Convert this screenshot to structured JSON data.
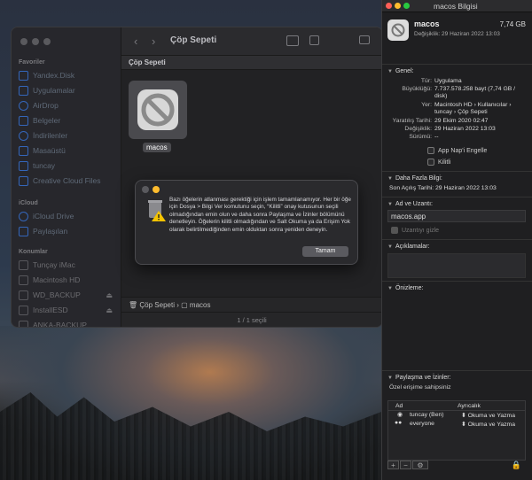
{
  "finder": {
    "title": "Çöp Sepeti",
    "path_header": "Çöp Sepeti",
    "sidebar": {
      "favorites_header": "Favoriler",
      "favorites": [
        "Yandex.Disk",
        "Uygulamalar",
        "AirDrop",
        "Belgeler",
        "İndirilenler",
        "Masaüstü",
        "tuncay",
        "Creative Cloud Files"
      ],
      "icloud_header": "iCloud",
      "icloud": [
        "iCloud Drive",
        "Paylaşılan"
      ],
      "locations_header": "Konumlar",
      "locations": [
        "Tunçay iMac",
        "Macintosh HD",
        "WD_BACKUP",
        "InstallESD",
        "ANKA-BACKUP"
      ]
    },
    "file_label": "macos",
    "pathbar_trash": "Çöp Sepeti",
    "pathbar_sep": "›",
    "pathbar_file": "macos",
    "status": "1 / 1 seçili"
  },
  "alert": {
    "message": "Bazı öğelerin atlanması gerektiği için işlem tamamlanamıyor. Her bir öğe için Dosya > Bilgi Ver komutunu seçin, “Kilitli” onay kutusunun seçili olmadığından emin olun ve daha sonra Paylaşma ve İzinler bölümünü denetleyin. Öğelerin kilitli olmadığından ve Salt Okuma ya da Erişim Yok olarak belirtilmediğinden emin olduktan sonra yeniden deneyin.",
    "ok_label": "Tamam"
  },
  "info": {
    "window_title": "macos Bilgisi",
    "name": "macos",
    "size": "7,74 GB",
    "modified_line": "Değişiklik: 29 Haziran 2022 13:03",
    "general_header": "Genel:",
    "type_k": "Tür:",
    "type_v": "Uygulama",
    "size_k": "Büyüklüğü:",
    "size_v": "7.737.578.258 bayt (7,74 GB / disk)",
    "where_k": "Yer:",
    "where_v": "Macintosh HD › Kullanıcılar › tuncay › Çöp Sepeti",
    "created_k": "Yaratılış Tarihi:",
    "created_v": "29 Ekim 2020 02:47",
    "modified_k": "Değişiklik:",
    "modified_v": "29 Haziran 2022 13:03",
    "version_k": "Sürümü:",
    "version_v": "--",
    "appnap_label": "App Nap'i Engelle",
    "locked_label": "Kilitli",
    "more_header": "Daha Fazla Bilgi:",
    "last_opened": "Son Açılış Tarihi: 29 Haziran 2022 13:03",
    "name_ext_header": "Ad ve Uzantı:",
    "name_field": "macos.app",
    "hide_ext_label": "Uzantıyı gizle",
    "comments_header": "Açıklamalar:",
    "preview_header": "Önizleme:",
    "sharing_header": "Paylaşma ve İzinler:",
    "sharing_sub": "Özel erişime sahipsiniz",
    "col_name": "Ad",
    "col_priv": "Ayrıcalık",
    "perms": [
      {
        "name": "tuncay (Ben)",
        "priv": "Okuma ve Yazma"
      },
      {
        "name": "everyone",
        "priv": "Okuma ve Yazma"
      }
    ]
  }
}
